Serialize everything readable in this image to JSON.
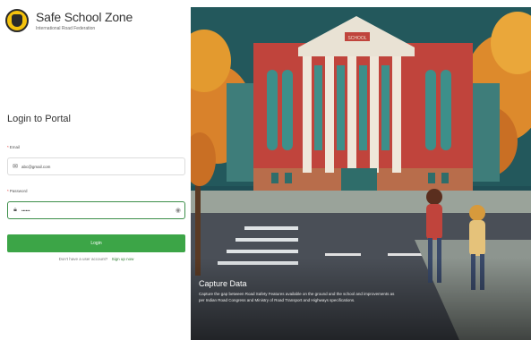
{
  "brand": {
    "title": "Safe School Zone",
    "subtitle": "International Road Federation",
    "logo_icon": "school-shield-icon"
  },
  "login": {
    "heading": "Login to Portal",
    "email_label": "Email",
    "email_value": "abc@gmail.com",
    "email_icon": "mail-icon",
    "password_label": "Password",
    "password_value": "••••••",
    "password_icon": "lock-icon",
    "visibility_icon": "eye-icon",
    "login_button": "Login",
    "signup_prompt": "Don't have a user account?",
    "signup_link": "Sign up now",
    "required_mark": "*"
  },
  "hero": {
    "caption_title": "Capture Data",
    "caption_text": "Capture the gap between Road Safety Features available on the ground and the school and improvements as per Indian Road Congress and Ministry of Road Transport and Highways specifications.",
    "building_sign": "SCHOOL"
  },
  "colors": {
    "accent": "#3ca547",
    "building": "#c0443c",
    "sky": "#1f4e55",
    "road": "#4a4f57"
  }
}
